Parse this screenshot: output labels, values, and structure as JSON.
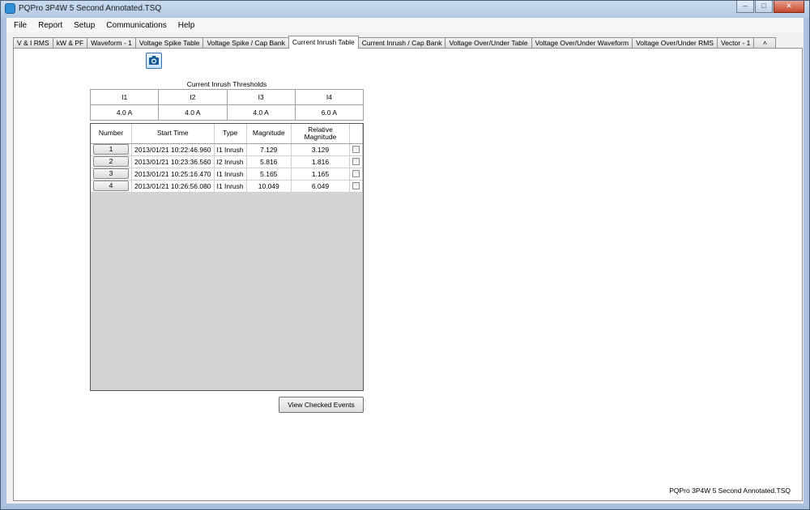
{
  "window": {
    "title": "PQPro 3P4W 5 Second Annotated.TSQ",
    "controls": {
      "minimize": "–",
      "maximize": "□",
      "close": "✕"
    }
  },
  "menu": [
    "File",
    "Report",
    "Setup",
    "Communications",
    "Help"
  ],
  "tabs": [
    "V & I RMS",
    "kW & PF",
    "Waveform - 1",
    "Voltage Spike Table",
    "Voltage Spike / Cap Bank",
    "Current Inrush Table",
    "Current Inrush / Cap Bank",
    "Voltage Over/Under Table",
    "Voltage Over/Under Waveform",
    "Voltage Over/Under RMS",
    "Vector - 1"
  ],
  "active_tab": "Current Inrush Table",
  "tab_scroll_glyph": "˄",
  "camera_icon": "camera-icon",
  "thresholds": {
    "caption": "Current Inrush Thresholds",
    "headers": [
      "I1",
      "I2",
      "I3",
      "I4"
    ],
    "values": [
      "4.0 A",
      "4.0 A",
      "4.0 A",
      "6.0 A"
    ]
  },
  "events": {
    "columns": {
      "number": "Number",
      "start_time": "Start Time",
      "type": "Type",
      "magnitude": "Magnitude",
      "relative_line1": "Relative",
      "relative_line2": "Magnitude"
    },
    "rows": [
      {
        "number": "1",
        "start_time": "2013/01/21 10:22:46.960",
        "type": "I1 Inrush",
        "magnitude": "7.129",
        "relative": "3.129"
      },
      {
        "number": "2",
        "start_time": "2013/01/21 10:23:36.560",
        "type": "I2 Inrush",
        "magnitude": "5.816",
        "relative": "1.816"
      },
      {
        "number": "3",
        "start_time": "2013/01/21 10:25:16.470",
        "type": "I1 Inrush",
        "magnitude": "5.165",
        "relative": "1.165"
      },
      {
        "number": "4",
        "start_time": "2013/01/21 10:26:56.080",
        "type": "I1 Inrush",
        "magnitude": "10.049",
        "relative": "6.049"
      }
    ]
  },
  "view_button": "View Checked Events",
  "status_filename": "PQPro 3P4W 5 Second Annotated.TSQ"
}
